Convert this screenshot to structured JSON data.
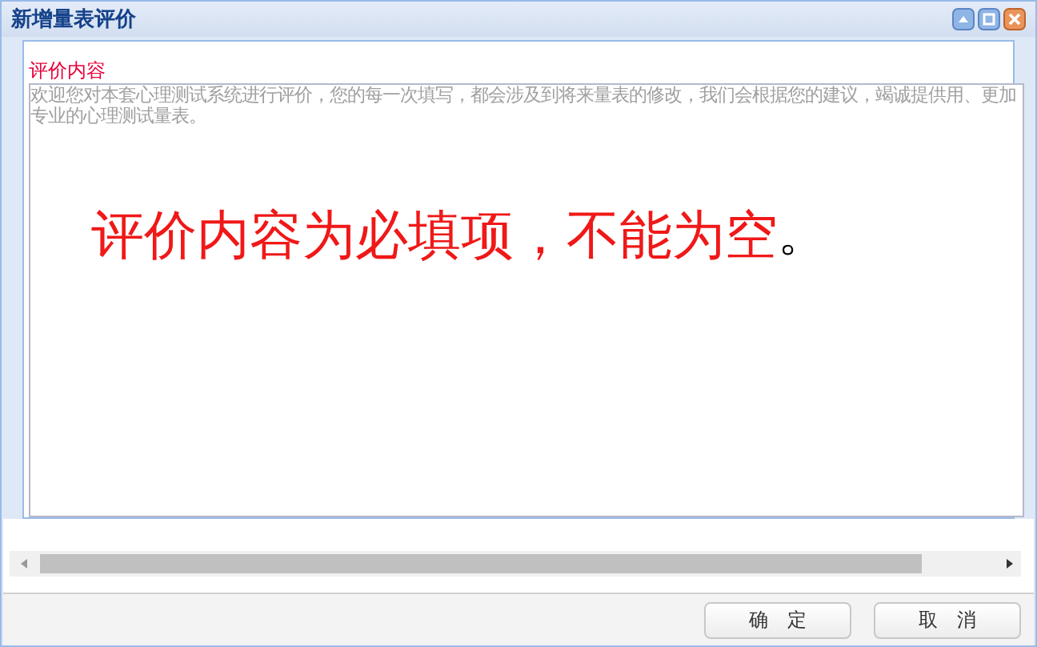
{
  "window": {
    "title": "新增量表评价"
  },
  "form": {
    "label": "评价内容",
    "placeholder": "欢迎您对本套心理测试系统进行评价，您的每一次填写，都会涉及到将来量表的修改，我们会根据您的建议，竭诚提供用、更加专业的心理测试量表。"
  },
  "annotation": {
    "text": "评价内容为必填项，不能为空",
    "end": "。"
  },
  "buttons": [
    "确　定",
    "取　消"
  ]
}
